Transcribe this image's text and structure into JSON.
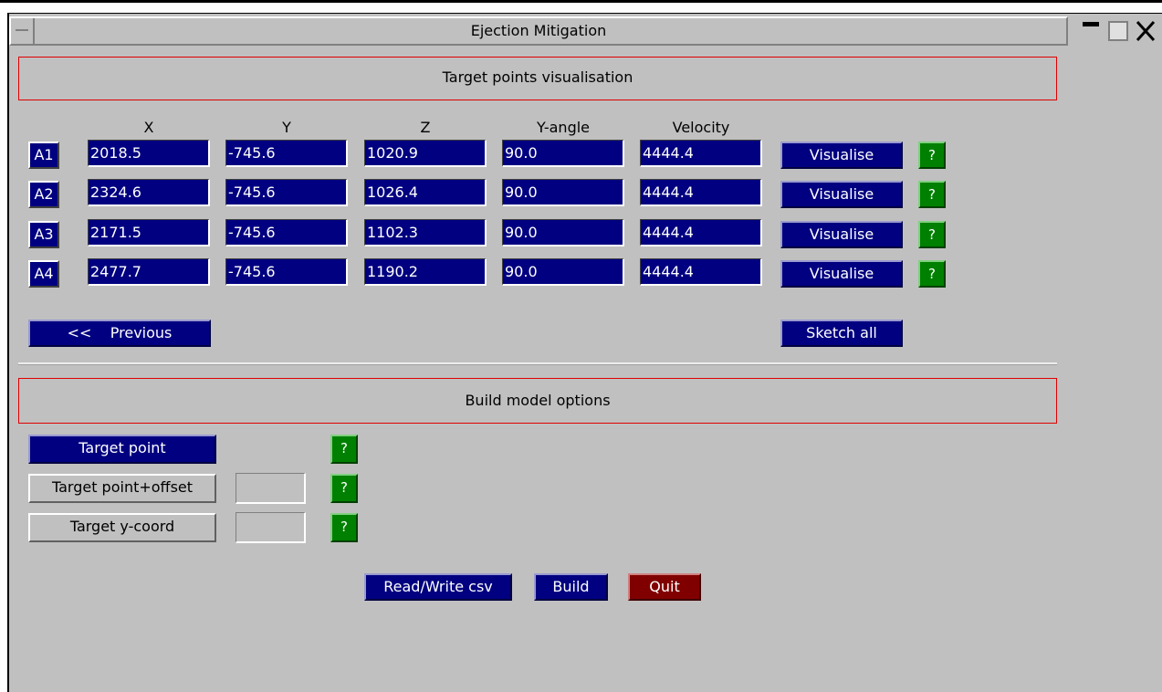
{
  "window": {
    "title": "Ejection Mitigation"
  },
  "section1": {
    "title": "Target points visualisation"
  },
  "columns": [
    "X",
    "Y",
    "Z",
    "Y-angle",
    "Velocity"
  ],
  "rows": [
    {
      "label": "A1",
      "x": "2018.5",
      "y": "-745.6",
      "z": "1020.9",
      "yangle": "90.0",
      "velocity": "4444.4",
      "visualise": "Visualise",
      "help": "?"
    },
    {
      "label": "A2",
      "x": "2324.6",
      "y": "-745.6",
      "z": "1026.4",
      "yangle": "90.0",
      "velocity": "4444.4",
      "visualise": "Visualise",
      "help": "?"
    },
    {
      "label": "A3",
      "x": "2171.5",
      "y": "-745.6",
      "z": "1102.3",
      "yangle": "90.0",
      "velocity": "4444.4",
      "visualise": "Visualise",
      "help": "?"
    },
    {
      "label": "A4",
      "x": "2477.7",
      "y": "-745.6",
      "z": "1190.2",
      "yangle": "90.0",
      "velocity": "4444.4",
      "visualise": "Visualise",
      "help": "?"
    }
  ],
  "nav": {
    "previous": "<<    Previous",
    "sketch_all": "Sketch all"
  },
  "section2": {
    "title": "Build model options"
  },
  "options": [
    {
      "label": "Target point",
      "help": "?",
      "selected": true
    },
    {
      "label": "Target point+offset",
      "value": "",
      "help": "?",
      "selected": false
    },
    {
      "label": "Target y-coord",
      "value": "",
      "help": "?",
      "selected": false
    }
  ],
  "footer": {
    "readwrite": "Read/Write csv",
    "build": "Build",
    "quit": "Quit"
  },
  "colors": {
    "field": "#000080",
    "help": "#008000",
    "quit": "#800000",
    "panel": "#c0c0c0",
    "section_border": "#e00000"
  }
}
